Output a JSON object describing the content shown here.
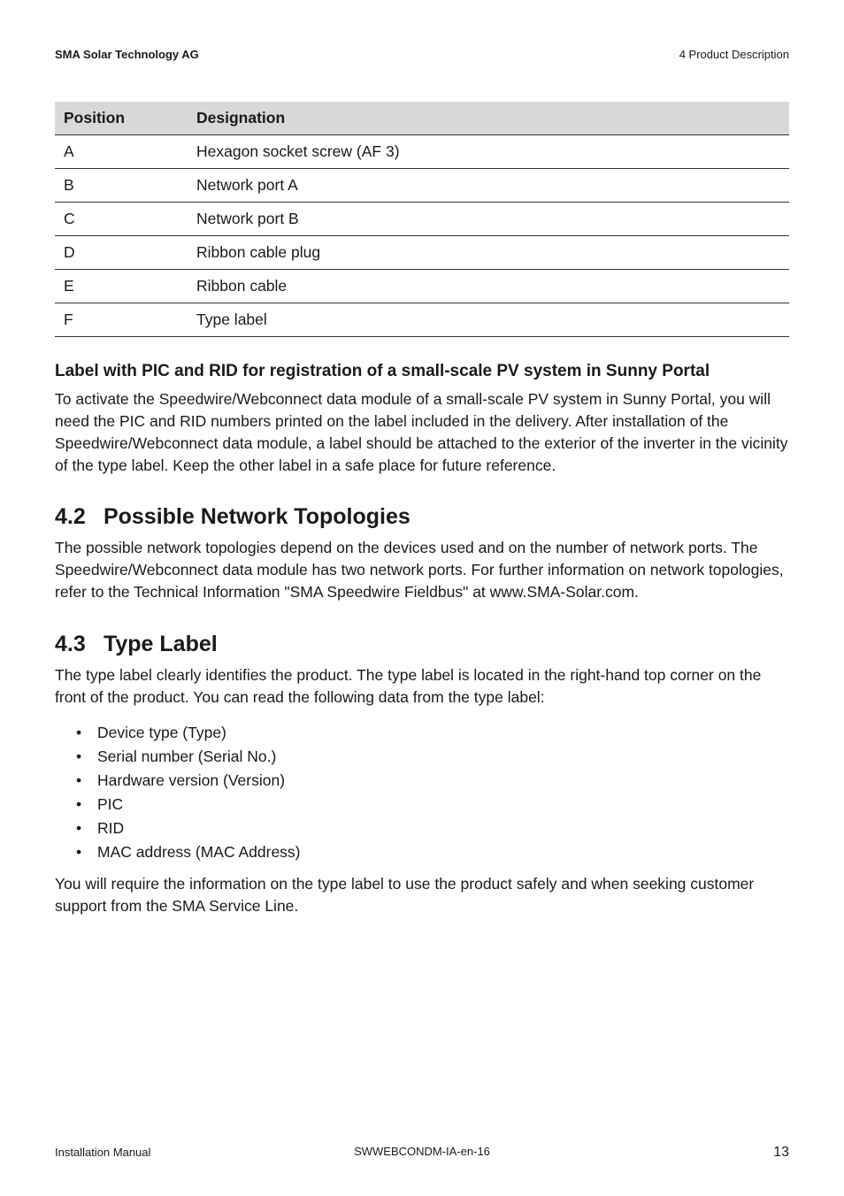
{
  "header": {
    "left": "SMA Solar Technology AG",
    "right": "4  Product Description"
  },
  "table": {
    "col_position": "Position",
    "col_designation": "Designation",
    "rows": [
      {
        "pos": "A",
        "des": "Hexagon socket screw (AF 3)"
      },
      {
        "pos": "B",
        "des": "Network port A"
      },
      {
        "pos": "C",
        "des": "Network port B"
      },
      {
        "pos": "D",
        "des": "Ribbon cable plug"
      },
      {
        "pos": "E",
        "des": "Ribbon cable"
      },
      {
        "pos": "F",
        "des": "Type label"
      }
    ]
  },
  "label_section": {
    "heading": "Label with PIC and RID for registration of a small-scale PV system in Sunny Portal",
    "paragraph": "To activate the Speedwire/Webconnect data module of a small-scale PV system in Sunny Portal, you will need the PIC and RID numbers printed on the label included in the delivery. After installation of the Speedwire/Webconnect data module, a label should be attached to the exterior of the inverter in the vicinity of the type label. Keep the other label in a safe place for future reference."
  },
  "section_4_2": {
    "num": "4.2",
    "title": "Possible Network Topologies",
    "paragraph": "The possible network topologies depend on the devices used and on the number of network ports. The Speedwire/Webconnect data module has two network ports. For further information on network topologies, refer to the Technical Information \"SMA Speedwire Fieldbus\" at www.SMA-Solar.com."
  },
  "section_4_3": {
    "num": "4.3",
    "title": "Type Label",
    "intro": "The type label clearly identifies the product. The type label is located in the right-hand top corner on the front of the product. You can read the following data from the type label:",
    "items": [
      "Device type (Type)",
      "Serial number (Serial No.)",
      "Hardware version (Version)",
      "PIC",
      "RID",
      "MAC address (MAC Address)"
    ],
    "outro": "You will require the information on the type label to use the product safely and when seeking customer support from the SMA Service Line."
  },
  "footer": {
    "left": "Installation Manual",
    "center": "SWWEBCONDM-IA-en-16",
    "page": "13"
  }
}
